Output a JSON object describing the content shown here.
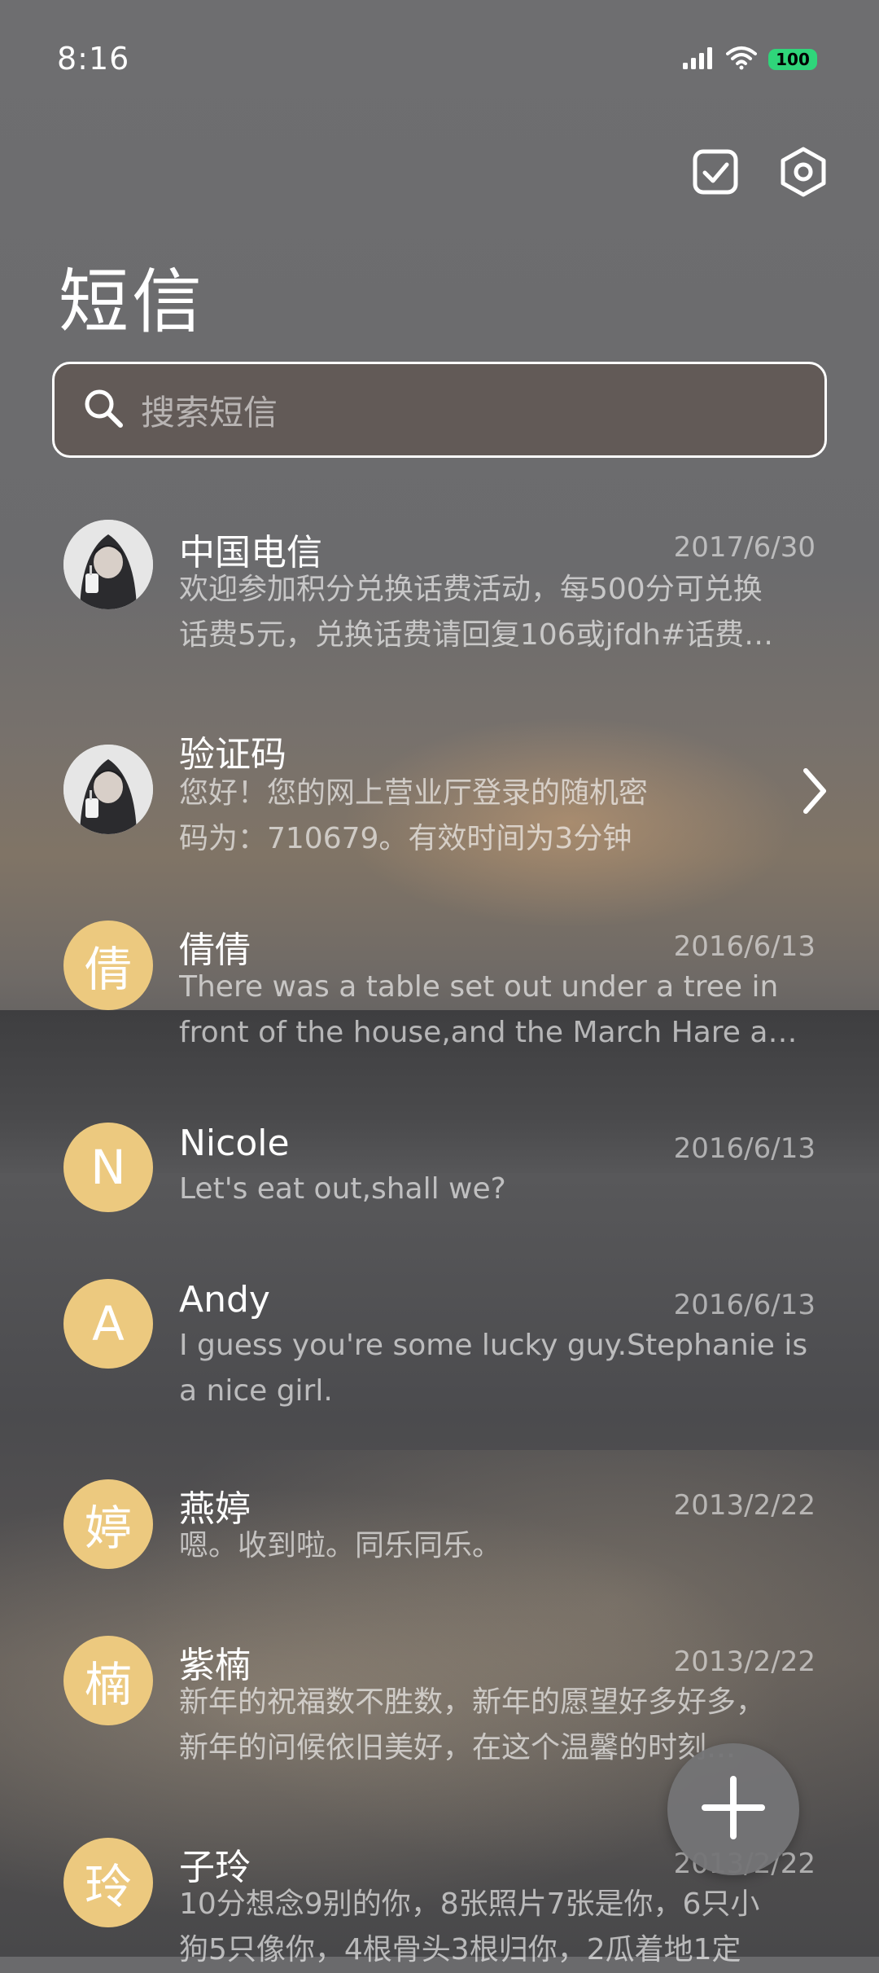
{
  "status_bar": {
    "time": "8:16",
    "battery": "100",
    "signal_icon": "cellular-signal-icon",
    "wifi_icon": "wifi-icon"
  },
  "header": {
    "title": "短信",
    "select_icon": "checkbox-icon",
    "settings_icon": "settings-hexagon-icon"
  },
  "search": {
    "placeholder": "搜索短信",
    "icon": "search-icon"
  },
  "conversations": [
    {
      "name": "中国电信",
      "date": "2017/6/30",
      "avatar": "photo",
      "preview_lines": [
        "欢迎参加积分兑换话费活动，每500分可兑换",
        "话费5元，兑换话费请回复106或jfdh#话费…"
      ]
    },
    {
      "name": "验证码",
      "date": "",
      "avatar": "photo",
      "preview_lines": [
        "您好！您的网上营业厅登录的随机密",
        "码为：710679。有效时间为3分钟"
      ],
      "chevron": "chevron-right-icon"
    },
    {
      "name": "倩倩",
      "date": "2016/6/13",
      "avatar": "倩",
      "preview_lines": [
        "There was a table set out under a tree in",
        "front of the house,and the March Hare an…"
      ]
    },
    {
      "name": "Nicole",
      "date": "2016/6/13",
      "avatar": "N",
      "preview_lines": [
        "Let's eat out,shall we?"
      ]
    },
    {
      "name": "Andy",
      "date": "2016/6/13",
      "avatar": "A",
      "preview_lines": [
        "I guess you're some lucky guy.Stephanie is",
        "a nice girl."
      ]
    },
    {
      "name": "燕婷",
      "date": "2013/2/22",
      "avatar": "婷",
      "preview_lines": [
        "嗯。收到啦。同乐同乐。"
      ]
    },
    {
      "name": "紫楠",
      "date": "2013/2/22",
      "avatar": "楠",
      "preview_lines": [
        "新年的祝福数不胜数，新年的愿望好多好多，",
        "新年的问候依旧美好，在这个温馨的时刻…"
      ]
    },
    {
      "name": "子玲",
      "date": "2013/2/22",
      "avatar": "玲",
      "preview_lines": [
        "10分想念9别的你，8张照片7张是你，6只小",
        "狗5只像你，4根骨头3根归你，2瓜着地1定"
      ]
    }
  ],
  "fab": {
    "icon": "plus-icon"
  },
  "colors": {
    "avatar_bg": "#ecc97f",
    "battery": "#2fd57a"
  }
}
